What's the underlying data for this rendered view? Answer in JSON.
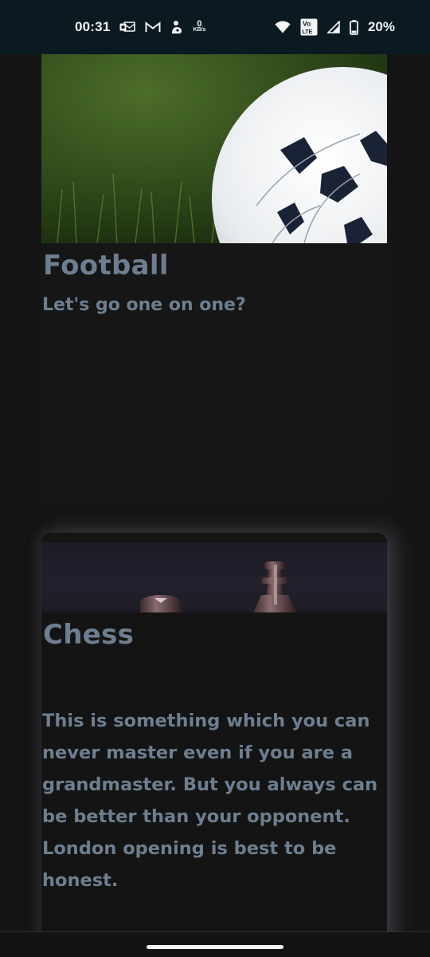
{
  "status_bar": {
    "time": "00:31",
    "net_speed_value": "0",
    "net_speed_unit": "KB/s",
    "volte_label_top": "Vo",
    "volte_label_bottom": "LTE",
    "battery": "20%",
    "icons": [
      "outlook-icon",
      "gmail-icon",
      "app-notification-icon",
      "wifi-icon",
      "volte-icon",
      "signal-icon",
      "battery-icon"
    ]
  },
  "cards": [
    {
      "title": "Football",
      "text": "Let's go one on one?",
      "image": "football-on-grass"
    },
    {
      "title": "Chess",
      "text": "This is something which you can never master even if you are a grandmaster. But you always can be better than your opponent. London opening is best to be honest.",
      "image": "chess-pieces"
    }
  ],
  "colors": {
    "background": "#151515",
    "status_bar": "#0b1a20",
    "text": "#6d7e90"
  }
}
